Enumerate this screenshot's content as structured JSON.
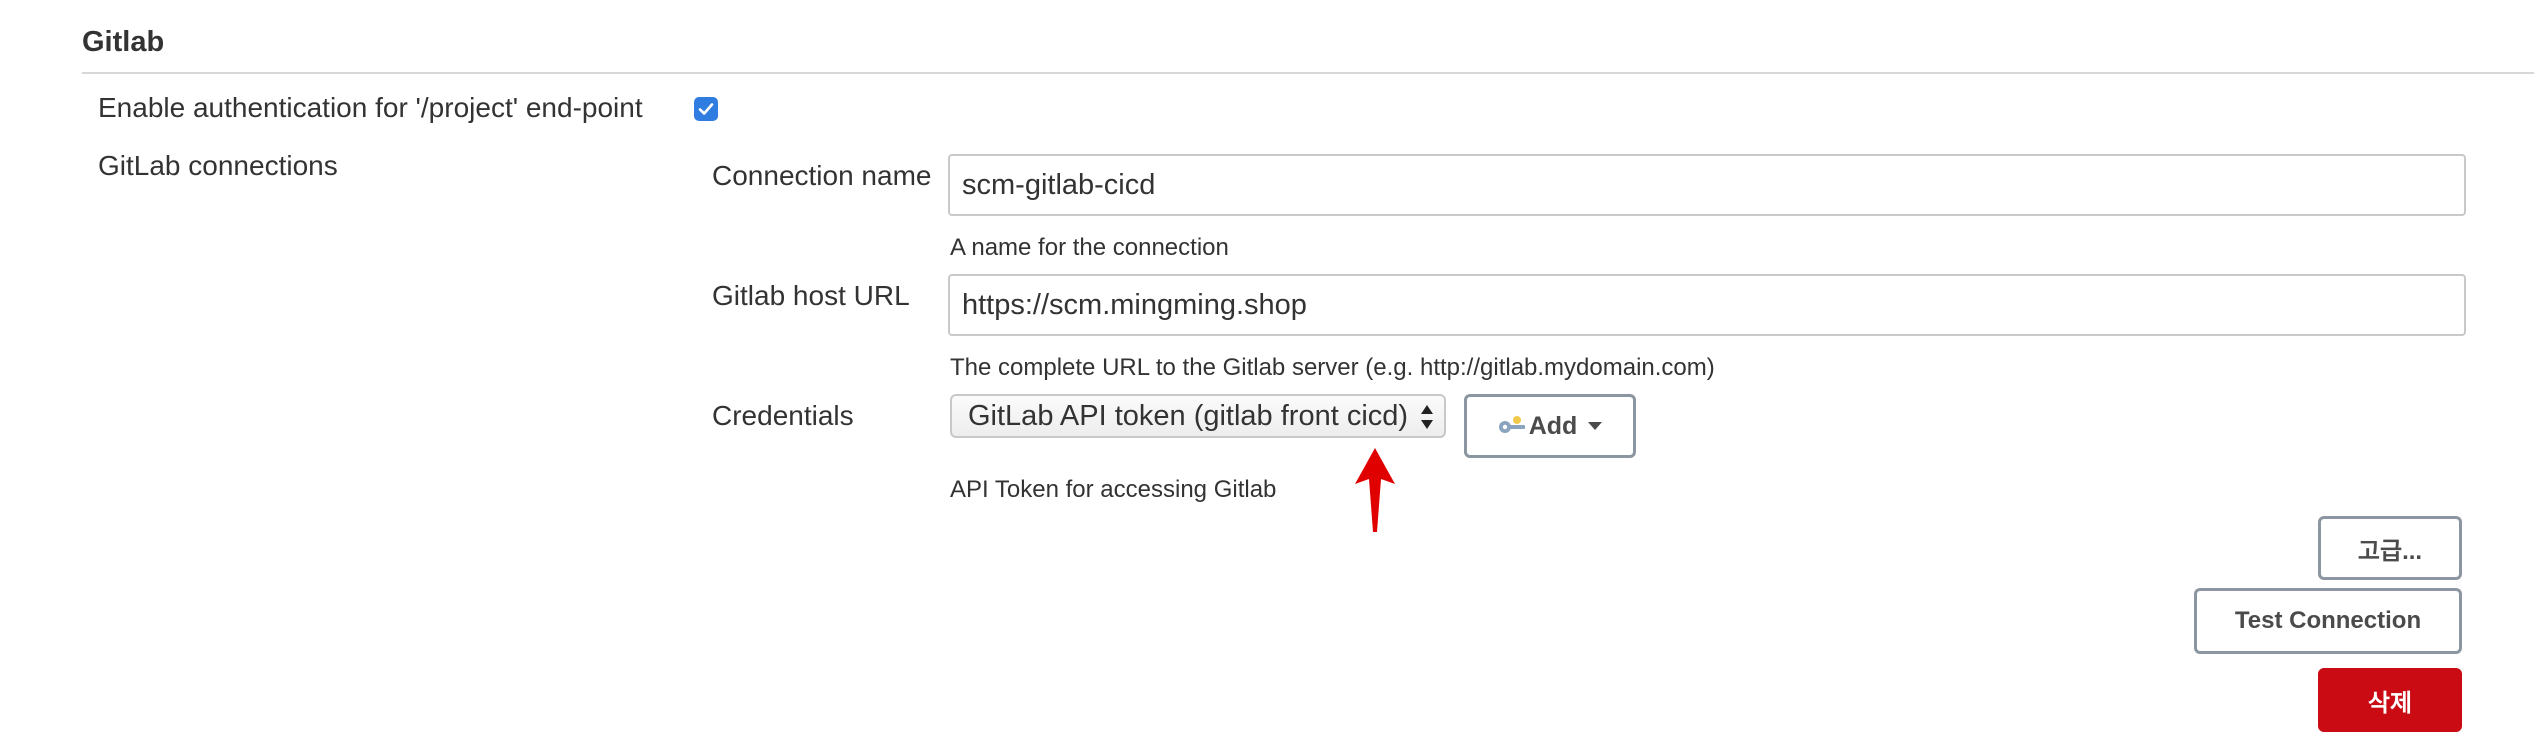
{
  "section": {
    "title": "Gitlab"
  },
  "auth": {
    "label": "Enable authentication for '/project' end-point",
    "checked": true
  },
  "connections": {
    "label": "GitLab connections",
    "connection_name": {
      "label": "Connection name",
      "value": "scm-gitlab-cicd",
      "help": "A name for the connection"
    },
    "host_url": {
      "label": "Gitlab host URL",
      "value": "https://scm.mingming.shop",
      "help": "The complete URL to the Gitlab server (e.g. http://gitlab.mydomain.com)"
    },
    "credentials": {
      "label": "Credentials",
      "selected": "GitLab API token (gitlab front cicd)",
      "add_label": "Add",
      "help": "API Token for accessing Gitlab"
    }
  },
  "buttons": {
    "advanced": "고급...",
    "test_connection": "Test Connection",
    "delete": "삭제"
  },
  "colors": {
    "checkbox": "#2f7de1",
    "delete_button": "#cb0b13",
    "annotation_arrow": "#e00000"
  },
  "icons": {
    "credentials_add": "key-icon",
    "add_dropdown": "caret-down-icon",
    "select_arrows": "updown-arrows-icon",
    "annotation": "red-arrow-annotation"
  }
}
